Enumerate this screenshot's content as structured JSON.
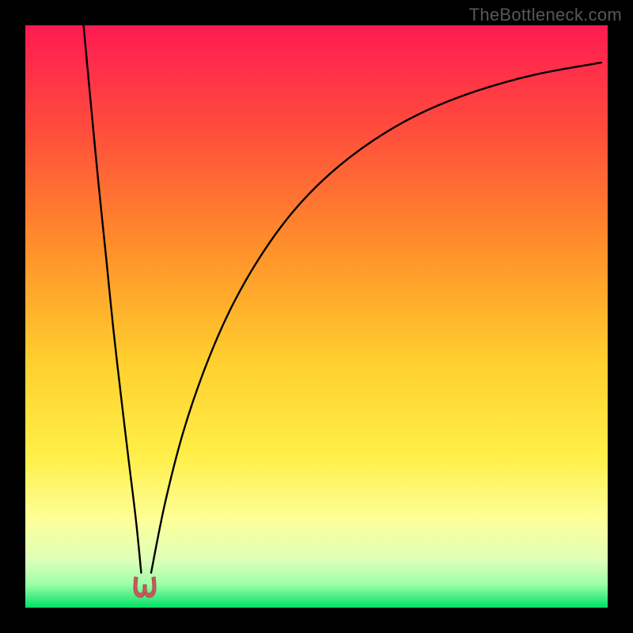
{
  "watermark": "TheBottleneck.com",
  "colors": {
    "black": "#000000",
    "curve": "#000000",
    "marker_fill": "#c95a5a",
    "marker_stroke": "#b24a4a",
    "grad_top": "#ff1a52",
    "grad_mid1": "#ff6a2e",
    "grad_mid2": "#ffb029",
    "grad_mid3": "#ffe637",
    "grad_mid4": "#fdfca0",
    "grad_mid5": "#d8ffbb",
    "grad_bottom": "#00e66a"
  },
  "gradient_stops": [
    {
      "offset": "0%",
      "color": "#ff1a52"
    },
    {
      "offset": "18%",
      "color": "#ff4d3c"
    },
    {
      "offset": "38%",
      "color": "#ff8f2a"
    },
    {
      "offset": "58%",
      "color": "#ffd02e"
    },
    {
      "offset": "74%",
      "color": "#ffef48"
    },
    {
      "offset": "85%",
      "color": "#feff9a"
    },
    {
      "offset": "92%",
      "color": "#dcffb8"
    },
    {
      "offset": "96%",
      "color": "#9cffa8"
    },
    {
      "offset": "100%",
      "color": "#00e066"
    }
  ],
  "marker": {
    "x_pct": 20.5,
    "y_pct": 96.5
  },
  "chart_data": {
    "type": "line",
    "title": "",
    "xlabel": "",
    "ylabel": "",
    "xlim": [
      0,
      100
    ],
    "ylim": [
      0,
      100
    ],
    "series": [
      {
        "name": "left-branch",
        "x": [
          10.0,
          11.3,
          12.6,
          13.9,
          15.1,
          16.4,
          17.7,
          19.0,
          19.9
        ],
        "y": [
          100.0,
          86.0,
          72.5,
          59.9,
          48.0,
          36.6,
          25.7,
          15.0,
          6.0
        ]
      },
      {
        "name": "right-branch",
        "x": [
          21.6,
          24.0,
          27.1,
          30.8,
          35.1,
          40.1,
          45.8,
          52.3,
          59.7,
          67.9,
          77.1,
          87.4,
          98.9
        ],
        "y": [
          6.0,
          18.0,
          30.1,
          41.0,
          51.0,
          59.9,
          67.8,
          74.5,
          80.2,
          84.9,
          88.6,
          91.5,
          93.6
        ]
      }
    ],
    "annotations": [
      {
        "type": "marker",
        "shape": "u-notch",
        "x": 20.5,
        "y": 3.5
      }
    ],
    "background": "vertical-gradient red→orange→yellow→green"
  }
}
